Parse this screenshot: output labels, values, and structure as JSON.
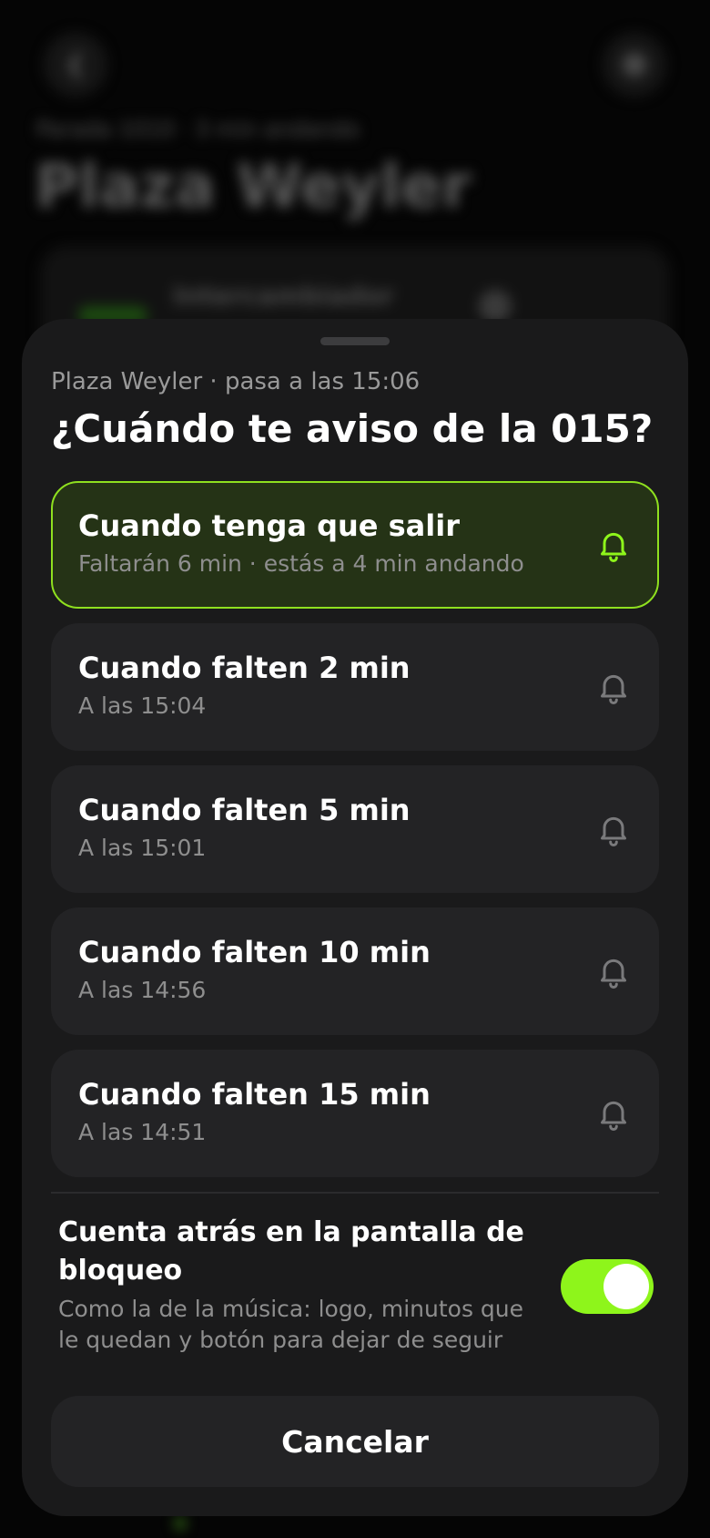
{
  "background": {
    "back_icon": "chevron-left-icon",
    "more_icon": "more-icon",
    "subtitle": "Parada 1010 · 3 min andando",
    "title": "Plaza Weyler",
    "card_text": "Intercambiador"
  },
  "sheet": {
    "subtitle": "Plaza Weyler · pasa a las 15:06",
    "title": "¿Cuándo te aviso de la 015?",
    "options": [
      {
        "title": "Cuando tenga que salir",
        "subtitle": "Faltarán 6 min · estás a 4 min andando",
        "selected": true,
        "icon": "bell-icon"
      },
      {
        "title": "Cuando falten 2 min",
        "subtitle": "A las 15:04",
        "selected": false,
        "icon": "bell-icon"
      },
      {
        "title": "Cuando falten 5 min",
        "subtitle": "A las 15:01",
        "selected": false,
        "icon": "bell-icon"
      },
      {
        "title": "Cuando falten 10 min",
        "subtitle": "A las 14:56",
        "selected": false,
        "icon": "bell-icon"
      },
      {
        "title": "Cuando falten 15 min",
        "subtitle": "A las 14:51",
        "selected": false,
        "icon": "bell-icon"
      }
    ],
    "lockscreen": {
      "title": "Cuenta atrás en la pantalla de bloqueo",
      "description": "Como la de la música: logo, minutos que le quedan y botón para dejar de seguir",
      "enabled": true
    },
    "cancel_label": "Cancelar"
  },
  "colors": {
    "accent": "#8ef51b",
    "selected_border": "#8fe01f",
    "selected_bg": "#253316",
    "sheet_bg": "#1a1a1b",
    "card_bg": "#232325"
  }
}
